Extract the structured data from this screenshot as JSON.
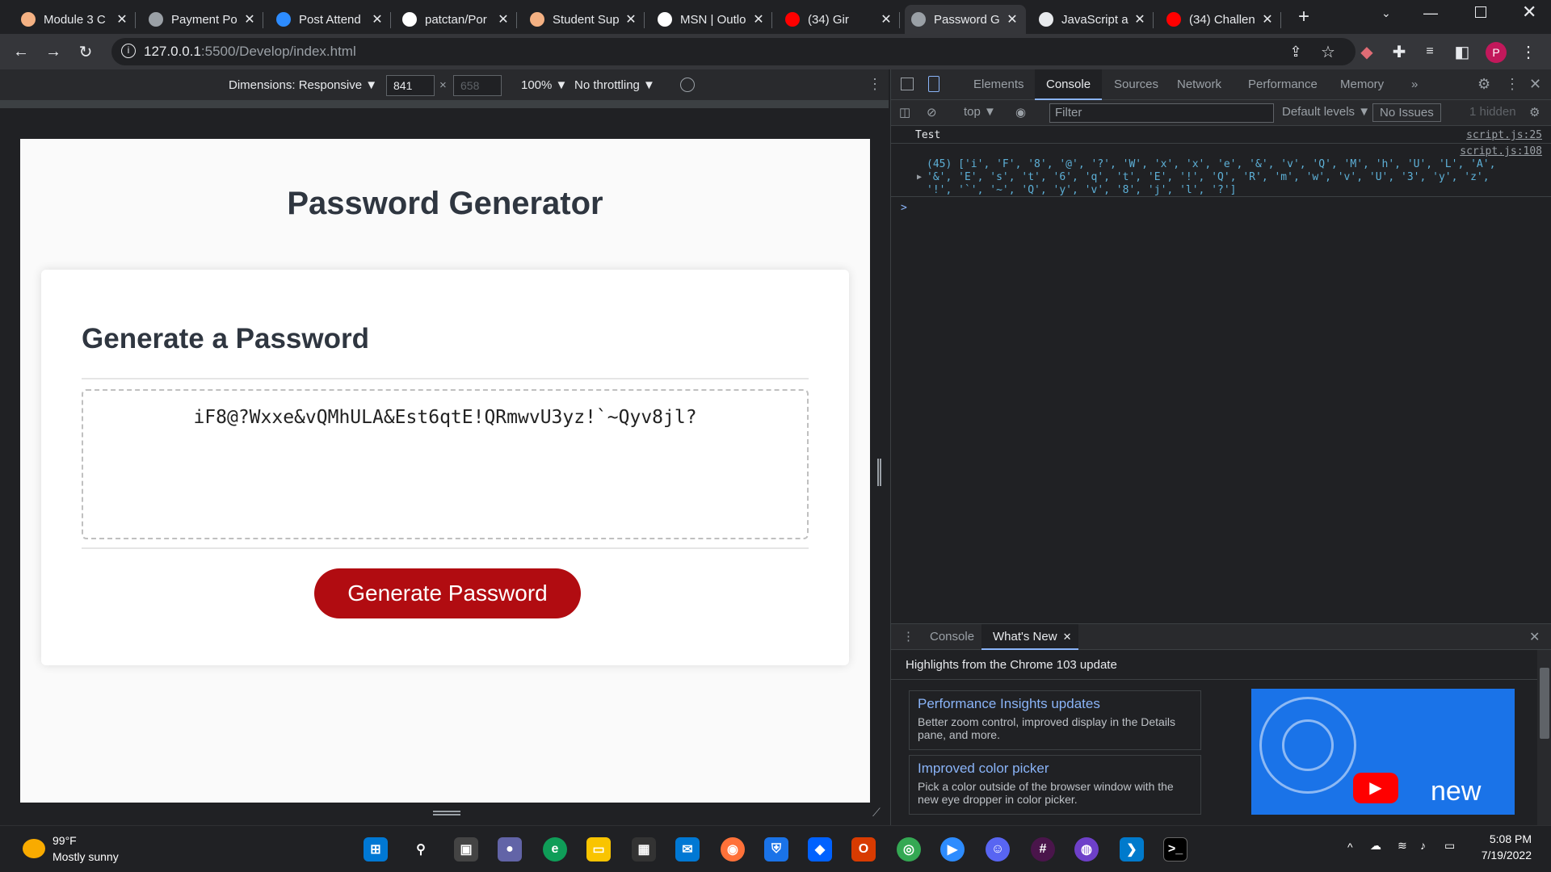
{
  "tabs": [
    {
      "title": "Module 3 C",
      "fav_color": "#f4b183",
      "active": false
    },
    {
      "title": "Payment Po",
      "fav_color": "#9aa0a6",
      "active": false
    },
    {
      "title": "Post Attend",
      "fav_color": "#2d8cff",
      "active": false
    },
    {
      "title": "patctan/Por",
      "fav_color": "#ffffff",
      "active": false
    },
    {
      "title": "Student Sup",
      "fav_color": "#f4b183",
      "active": false
    },
    {
      "title": "MSN | Outlo",
      "fav_color": "#ffffff",
      "active": false
    },
    {
      "title": "(34) Gir",
      "fav_color": "#ff0000",
      "active": false
    },
    {
      "title": "Password G",
      "fav_color": "#9aa0a6",
      "active": true
    },
    {
      "title": "JavaScript a",
      "fav_color": "#e8eaed",
      "active": false
    },
    {
      "title": "(34) Challen",
      "fav_color": "#ff0000",
      "active": false
    }
  ],
  "browser": {
    "url_host": "127.0.0.1",
    "url_path": ":5500/Develop/index.html",
    "profile_initial": "P"
  },
  "device_toolbar": {
    "dimensions_label": "Dimensions: Responsive ▼",
    "width": "841",
    "height": "658",
    "times": "×",
    "zoom": "100% ▼",
    "throttling": "No throttling ▼"
  },
  "page": {
    "title": "Password Generator",
    "card_title": "Generate a Password",
    "password": "iF8@?Wxxe&vQMhULA&Est6qtE!QRmwvU3yz!`~Qyv8jl?",
    "button_label": "Generate Password"
  },
  "devtools": {
    "tabs": [
      "Elements",
      "Console",
      "Sources",
      "Network",
      "Performance",
      "Memory",
      "»"
    ],
    "active_tab": "Console",
    "context": "top ▼",
    "filter_placeholder": "Filter",
    "levels": "Default levels ▼",
    "issues": "No Issues",
    "hidden": "1 hidden",
    "console_rows": [
      {
        "text": "Test",
        "source": "script.js:25"
      },
      {
        "text": "(45) ['i', 'F', '8', '@', '?', 'W', 'x', 'x', 'e', '&', 'v', 'Q', 'M', 'h', 'U', 'L', 'A',",
        "text2": "'&', 'E', 's', 't', '6', 'q', 't', 'E', '!', 'Q', 'R', 'm', 'w', 'v', 'U', '3', 'y', 'z',",
        "text3": "'!', '`', '~', 'Q', 'y', 'v', '8', 'j', 'l', '?']",
        "source": "script.js:108"
      }
    ],
    "prompt": ">",
    "drawer_tabs": [
      "Console",
      "What's New"
    ],
    "drawer_active": "What's New",
    "highlights": "Highlights from the Chrome 103 update",
    "cards": [
      {
        "title": "Performance Insights updates",
        "desc": "Better zoom control, improved display in the Details pane, and more."
      },
      {
        "title": "Improved color picker",
        "desc": "Pick a color outside of the browser window with the new eye dropper in color picker."
      }
    ],
    "video_label": "new"
  },
  "taskbar": {
    "weather_temp": "99°F",
    "weather_desc": "Mostly sunny",
    "time": "5:08 PM",
    "date": "7/19/2022"
  }
}
